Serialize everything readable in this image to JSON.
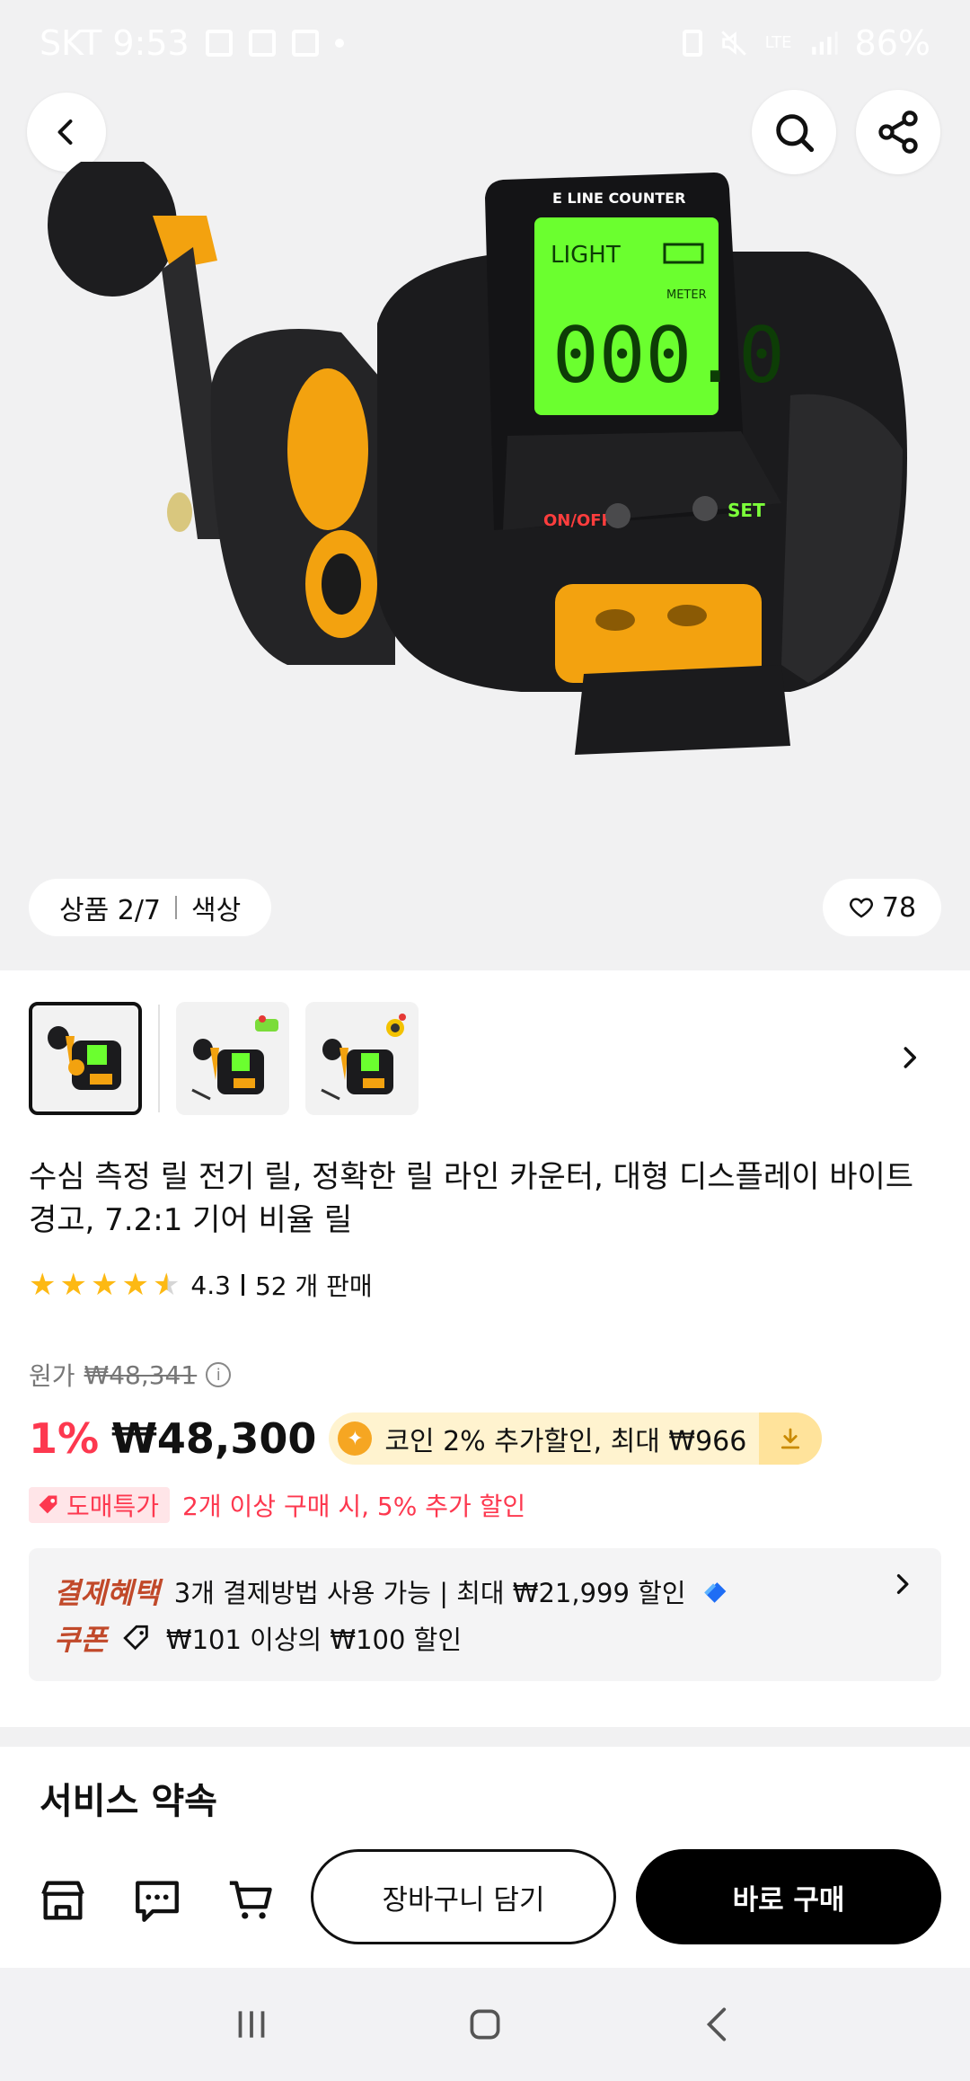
{
  "status_bar": {
    "carrier_time": "SKT 9:53",
    "network": "LTE",
    "battery": "86%"
  },
  "hero": {
    "lcd_brand": "E LINE COUNTER",
    "lcd_light": "LIGHT",
    "lcd_meter": "METER",
    "lcd_value": "000.0",
    "btn_onoff": "ON/OFF",
    "btn_set": "SET",
    "counter": "상품 2/7",
    "counter_tab": "색상",
    "likes": "78"
  },
  "product": {
    "title": "수심 측정 릴 전기 릴, 정확한 릴 라인 카운터, 대형 디스플레이 바이트 경고, 7.2:1 기어 비율 릴",
    "rating": "4.3",
    "sold": "52 개 판매"
  },
  "price": {
    "original_label": "원가",
    "original_value": "₩48,341",
    "discount": "1%",
    "current": "₩48,300",
    "coin_text": "코인 2% 추가할인, 최대 ₩966",
    "wholesale_badge": "도매특가",
    "wholesale_text": "2개 이상 구매 시, 5% 추가 할인"
  },
  "benefits": {
    "payment_label": "결제혜택",
    "payment_text": "3개 결제방법 사용 가능 | 최대 ₩21,999 할인",
    "coupon_label": "쿠폰",
    "coupon_text": "₩101 이상의 ₩100 할인"
  },
  "service": {
    "title": "서비스 약속"
  },
  "actions": {
    "add_to_cart": "장바구니 담기",
    "buy_now": "바로 구매"
  },
  "colors": {
    "accent_red": "#fd384f",
    "star": "#fdb913",
    "benefit_label": "#c1492a",
    "lcd_green": "#6bff2f",
    "reel_gold": "#f3a20f"
  }
}
